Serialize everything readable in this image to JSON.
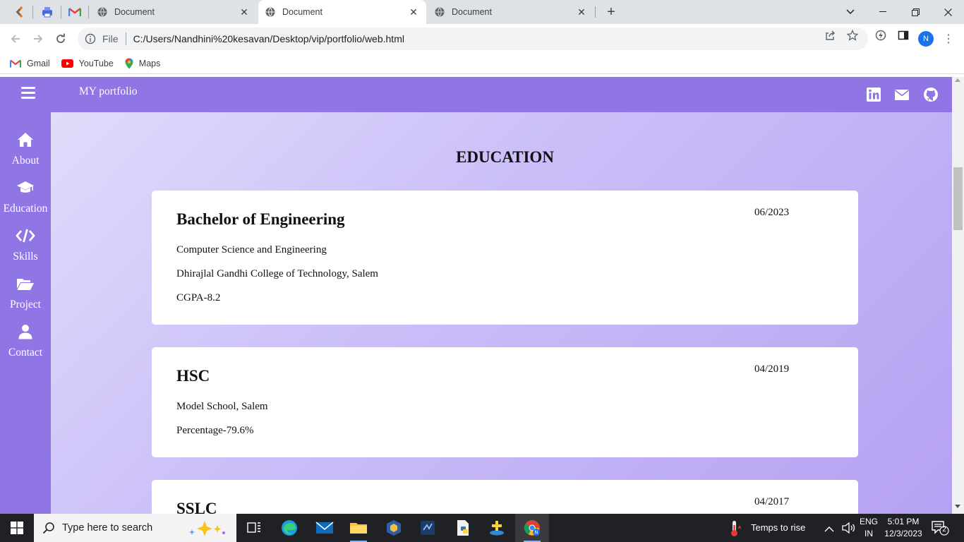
{
  "browser": {
    "tabs": [
      {
        "title": "Document",
        "active": false
      },
      {
        "title": "Document",
        "active": true
      },
      {
        "title": "Document",
        "active": false
      }
    ],
    "address": {
      "scheme_label": "File",
      "url": "C:/Users/Nandhini%20kesavan/Desktop/vip/portfolio/web.html"
    },
    "profile_initial": "N",
    "bookmarks": [
      {
        "label": "Gmail",
        "icon": "gmail-icon"
      },
      {
        "label": "YouTube",
        "icon": "youtube-icon"
      },
      {
        "label": "Maps",
        "icon": "maps-icon"
      }
    ]
  },
  "site": {
    "brand": "MY portfolio",
    "social_icons": [
      "linkedin-icon",
      "mail-icon",
      "github-icon"
    ],
    "nav": [
      {
        "label": "About",
        "icon": "home-icon"
      },
      {
        "label": "Education",
        "icon": "graduation-cap-icon"
      },
      {
        "label": "Skills",
        "icon": "code-icon"
      },
      {
        "label": "Project",
        "icon": "folder-open-icon"
      },
      {
        "label": "Contact",
        "icon": "user-icon"
      }
    ],
    "section_title": "EDUCATION",
    "education": [
      {
        "degree": "Bachelor of Engineering",
        "date": "06/2023",
        "lines": [
          "Computer Science and Engineering",
          "Dhirajlal Gandhi College of Technology, Salem",
          "CGPA-8.2"
        ]
      },
      {
        "degree": "HSC",
        "date": "04/2019",
        "lines": [
          "Model School, Salem",
          "Percentage-79.6%"
        ]
      },
      {
        "degree": "SSLC",
        "date": "04/2017",
        "lines": []
      }
    ]
  },
  "taskbar": {
    "search_placeholder": "Type here to search",
    "weather": "Temps to rise",
    "lang_line1": "ENG",
    "lang_line2": "IN",
    "time": "5:01 PM",
    "date": "12/3/2023",
    "notification_count": "2"
  },
  "colors": {
    "nav_purple": "#9075e4",
    "page_gradient_start": "#e4e0fb",
    "page_gradient_end": "#b5a1f2",
    "card_bg": "#ffffff",
    "taskbar_bg": "#202124"
  }
}
